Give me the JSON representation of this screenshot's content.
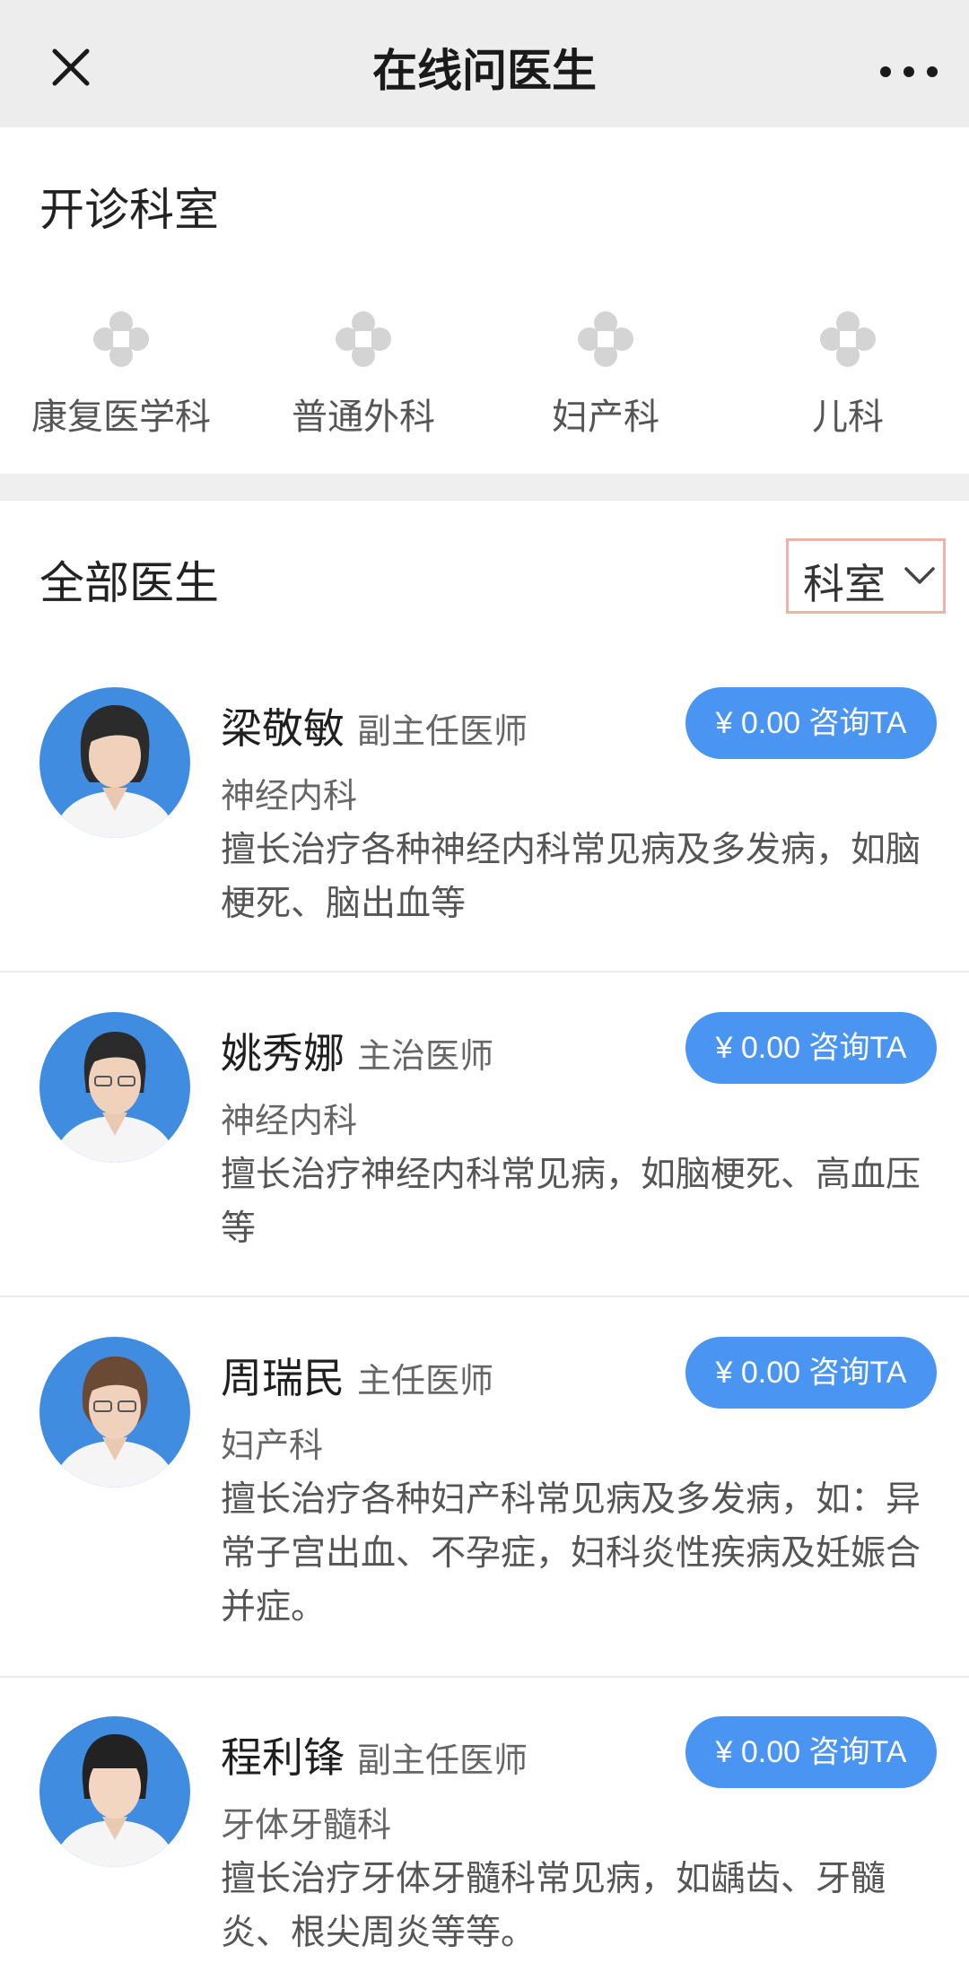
{
  "header": {
    "title": "在线问医生",
    "close_icon": "close-icon",
    "more_icon": "more-dots-icon"
  },
  "departments": {
    "title": "开诊科室",
    "icon": "medical-cross-icon",
    "items": [
      {
        "label": "康复医学科"
      },
      {
        "label": "普通外科"
      },
      {
        "label": "妇产科"
      },
      {
        "label": "儿科"
      }
    ]
  },
  "doctors": {
    "title": "全部医生",
    "filter_label": "科室",
    "filter_icon": "chevron-down-icon",
    "button_label": "¥ 0.00 咨询TA",
    "accent_color": "#4a95f2",
    "items": [
      {
        "name": "梁敬敏",
        "title": "副主任医师",
        "department": "神经内科",
        "desc": "擅长治疗各种神经内科常见病及多发病，如脑梗死、脑出血等"
      },
      {
        "name": "姚秀娜",
        "title": "主治医师",
        "department": "神经内科",
        "desc": "擅长治疗神经内科常见病，如脑梗死、高血压等"
      },
      {
        "name": "周瑞民",
        "title": "主任医师",
        "department": "妇产科",
        "desc": "擅长治疗各种妇产科常见病及多发病，如：异常子宫出血、不孕症，妇科炎性疾病及妊娠合并症。"
      },
      {
        "name": "程利锋",
        "title": "副主任医师",
        "department": "牙体牙髓科",
        "desc": "擅长治疗牙体牙髓科常见病，如龋齿、牙髓炎、根尖周炎等等。"
      }
    ]
  }
}
